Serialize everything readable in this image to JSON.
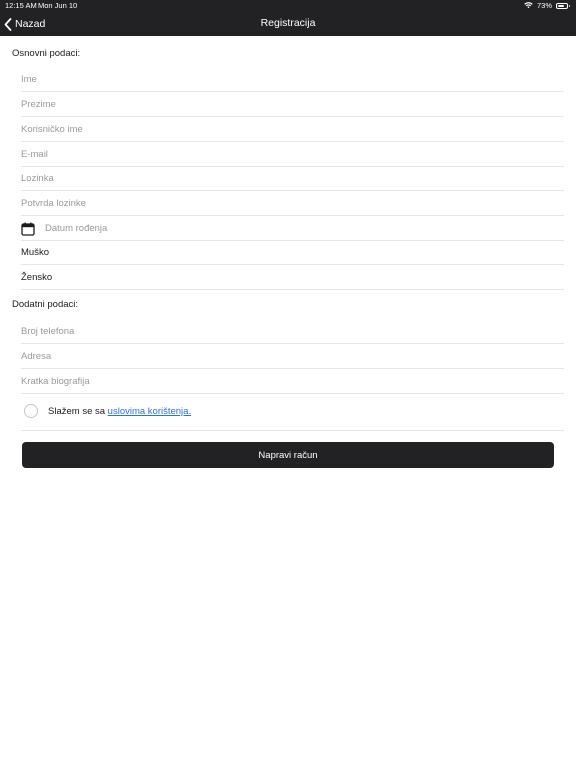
{
  "status_bar": {
    "time": "12:15 AM",
    "date": "Mon Jun 10",
    "battery_text": "73%",
    "battery_level": 0.73
  },
  "nav": {
    "back_label": "Nazad",
    "title": "Registracija"
  },
  "basic_section": {
    "title": "Osnovni podaci:",
    "fields": {
      "first_name": {
        "placeholder": "Ime",
        "value": ""
      },
      "last_name": {
        "placeholder": "Prezime",
        "value": ""
      },
      "username": {
        "placeholder": "Korisničko ime",
        "value": ""
      },
      "email": {
        "placeholder": "E-mail",
        "value": ""
      },
      "password": {
        "placeholder": "Lozinka",
        "value": ""
      },
      "password_confirm": {
        "placeholder": "Potvrda lozinke",
        "value": ""
      },
      "birth_date": {
        "placeholder": "Datum rođenja",
        "value": ""
      }
    },
    "gender_options": [
      "Muško",
      "Žensko"
    ]
  },
  "additional_section": {
    "title": "Dodatni podaci:",
    "fields": {
      "phone": {
        "placeholder": "Broj telefona",
        "value": ""
      },
      "address": {
        "placeholder": "Adresa",
        "value": ""
      },
      "bio": {
        "placeholder": "Kratka biografija",
        "value": ""
      }
    }
  },
  "terms": {
    "prefix": "Slažem se sa ",
    "link": "uslovima korištenja.",
    "checked": false,
    "link_color": "#2f6fd6"
  },
  "submit": {
    "label": "Napravi račun"
  },
  "colors": {
    "header_bg": "#222224",
    "button_bg": "#222224",
    "divider": "#e6e6e6",
    "placeholder": "#9a9a9e"
  }
}
